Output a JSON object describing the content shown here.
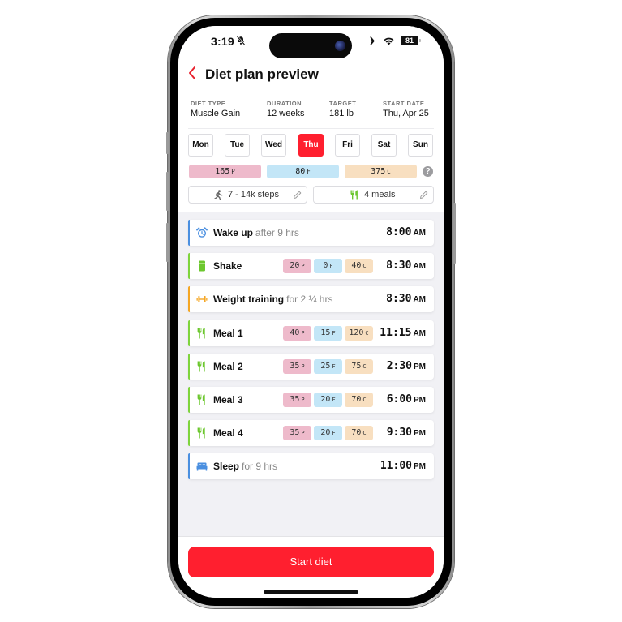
{
  "status_bar": {
    "time": "3:19",
    "battery": "81",
    "icons": [
      "bell-slash-icon",
      "airplane-icon",
      "wifi-icon",
      "battery-icon"
    ]
  },
  "nav": {
    "back_icon": "chevron-left-icon",
    "title": "Diet plan preview"
  },
  "plan": {
    "meta": [
      {
        "label": "DIET TYPE",
        "value": "Muscle Gain"
      },
      {
        "label": "DURATION",
        "value": "12 weeks"
      },
      {
        "label": "TARGET",
        "value": "181 lb"
      },
      {
        "label": "START DATE",
        "value": "Thu, Apr 25"
      }
    ],
    "days": [
      {
        "label": "Mon",
        "active": false
      },
      {
        "label": "Tue",
        "active": false
      },
      {
        "label": "Wed",
        "active": false
      },
      {
        "label": "Thu",
        "active": true
      },
      {
        "label": "Fri",
        "active": false
      },
      {
        "label": "Sat",
        "active": false
      },
      {
        "label": "Sun",
        "active": false
      }
    ],
    "daily_macros": {
      "protein": {
        "value": "165",
        "unit": "P"
      },
      "fat": {
        "value": "80",
        "unit": "F"
      },
      "carbs": {
        "value": "375",
        "unit": "C"
      }
    },
    "help_label": "?",
    "steps_chip": {
      "icon": "walking-icon",
      "label": "7 - 14k steps",
      "edit_icon": "pencil-icon"
    },
    "meals_chip": {
      "icon": "fork-knife-icon",
      "label": "4 meals",
      "edit_icon": "pencil-icon"
    }
  },
  "colors": {
    "accent_red": "#ff1f2f",
    "protein_bg": "#eebacb",
    "fat_bg": "#c3e6f7",
    "carbs_bg": "#f8dfc0",
    "blue_accent": "#4a8fe0",
    "green_accent": "#7ed43c",
    "orange_accent": "#f5a623"
  },
  "timeline": [
    {
      "type": "wake",
      "icon": "alarm-clock-icon",
      "name": "Wake up",
      "sub": "after 9 hrs",
      "time": "8:00",
      "ampm": "AM",
      "accent": "blue",
      "macros": null
    },
    {
      "type": "shake",
      "icon": "shake-cup-icon",
      "name": "Shake",
      "sub": "",
      "time": "8:30",
      "ampm": "AM",
      "accent": "green",
      "macros": {
        "p": "20",
        "f": "0",
        "c": "40"
      }
    },
    {
      "type": "training",
      "icon": "dumbbell-icon",
      "name": "Weight training",
      "sub": "for 2 ¼ hrs",
      "time": "8:30",
      "ampm": "AM",
      "accent": "orange",
      "macros": null
    },
    {
      "type": "meal",
      "icon": "fork-knife-icon",
      "name": "Meal 1",
      "sub": "",
      "time": "11:15",
      "ampm": "AM",
      "accent": "green",
      "macros": {
        "p": "40",
        "f": "15",
        "c": "120"
      }
    },
    {
      "type": "meal",
      "icon": "fork-knife-icon",
      "name": "Meal 2",
      "sub": "",
      "time": "2:30",
      "ampm": "PM",
      "accent": "green",
      "macros": {
        "p": "35",
        "f": "25",
        "c": "75"
      }
    },
    {
      "type": "meal",
      "icon": "fork-knife-icon",
      "name": "Meal 3",
      "sub": "",
      "time": "6:00",
      "ampm": "PM",
      "accent": "green",
      "macros": {
        "p": "35",
        "f": "20",
        "c": "70"
      }
    },
    {
      "type": "meal",
      "icon": "fork-knife-icon",
      "name": "Meal 4",
      "sub": "",
      "time": "9:30",
      "ampm": "PM",
      "accent": "green",
      "macros": {
        "p": "35",
        "f": "20",
        "c": "70"
      }
    },
    {
      "type": "sleep",
      "icon": "bed-icon",
      "name": "Sleep",
      "sub": "for 9 hrs",
      "time": "11:00",
      "ampm": "PM",
      "accent": "blue",
      "macros": null
    }
  ],
  "macro_units": {
    "p": "P",
    "f": "F",
    "c": "C"
  },
  "footer": {
    "start_label": "Start diet"
  }
}
